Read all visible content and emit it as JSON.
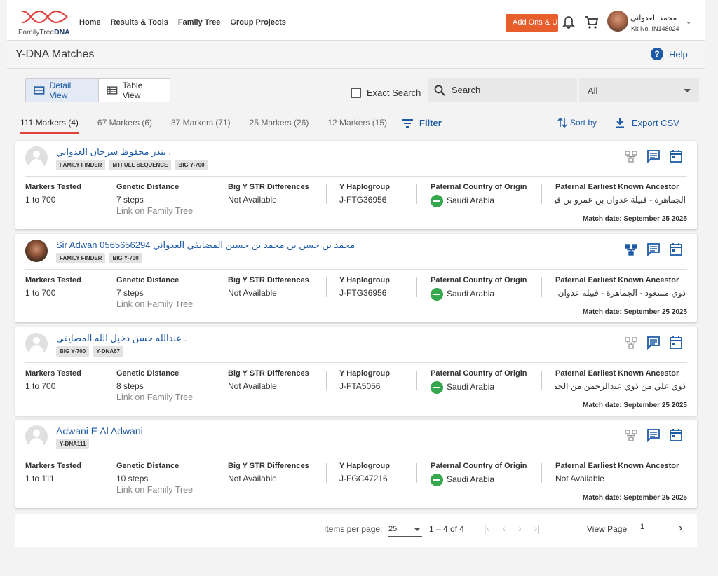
{
  "nav": {
    "logo_text_1": "FamilyTree",
    "logo_text_2": "DNA",
    "links": [
      "Home",
      "Results & Tools",
      "Family Tree",
      "Group Projects"
    ],
    "addons_label": "Add Ons & Upgrades",
    "user_name": "محمد العدواني",
    "kit_no": "Kit No. IN148024"
  },
  "page": {
    "title": "Y-DNA Matches",
    "help_label": "Help"
  },
  "toolbar": {
    "detail_view": "Detail View",
    "table_view": "Table View",
    "exact_search": "Exact Search",
    "search_placeholder": "Search",
    "search_scope": "All"
  },
  "tabs": [
    "111 Markers (4)",
    "67 Markers (6)",
    "37 Markers (71)",
    "25 Markers (26)",
    "12 Markers (15)"
  ],
  "actions": {
    "filter": "Filter",
    "sort_by": "Sort by",
    "export": "Export CSV"
  },
  "columns": {
    "markers": "Markers Tested",
    "distance": "Genetic Distance",
    "bigy": "Big Y STR Differences",
    "haplo": "Y Haplogroup",
    "country": "Paternal Country of Origin",
    "ancestor": "Paternal Earliest Known Ancestor",
    "link": "Link on Family Tree"
  },
  "matches": [
    {
      "name": "بندر محفوظ سرحان العدواني .",
      "badges": [
        "FAMILY FINDER",
        "MTFULL SEQUENCE",
        "BIG Y-700"
      ],
      "markers": "1 to 700",
      "distance": "7 steps",
      "bigy": "Not Available",
      "haplo": "J-FTG36956",
      "country": "Saudi Arabia",
      "ancestor": "الجماهرة - قبيلة عدوان بن عمرو بن قيس عيلان",
      "match_date": "Match date: September 25 2025"
    },
    {
      "name": "Sir Adwan 0565656294 محمد بن حسن بن محمد بن حسين المضايفي العدواني",
      "badges": [
        "FAMILY FINDER",
        "BIG Y-700"
      ],
      "markers": "1 to 700",
      "distance": "7 steps",
      "bigy": "Not Available",
      "haplo": "J-FTG36956",
      "country": "Saudi Arabia",
      "ancestor": "ذوي مسعود - الجماهرة - قبيلة عدوان",
      "match_date": "Match date: September 25 2025"
    },
    {
      "name": "عبدالله حسن دخيل الله المضايفي .",
      "badges": [
        "BIG Y-700",
        "Y-DNA67"
      ],
      "markers": "1 to 700",
      "distance": "8 steps",
      "bigy": "Not Available",
      "haplo": "J-FTA5056",
      "country": "Saudi Arabia",
      "ancestor": "ذوي علي من ذوي عبدالرحمن من الجماهرة...",
      "match_date": "Match date: September 25 2025"
    },
    {
      "name": "Adwani E Al Adwani",
      "badges": [
        "Y-DNA111"
      ],
      "markers": "1 to 111",
      "distance": "10 steps",
      "bigy": "Not Available",
      "haplo": "J-FGC47216",
      "country": "Saudi Arabia",
      "ancestor": "Not Available",
      "match_date": "Match date: September 25 2025"
    }
  ],
  "pager": {
    "items_label": "Items per page:",
    "items_value": "25",
    "range": "1 – 4 of 4",
    "view_page_label": "View Page",
    "page_value": "1"
  },
  "colors": {
    "brand_blue": "#1d5aa6",
    "accent_orange": "#e85d2c",
    "tab_underline": "#e0413a",
    "flag_green": "#35a74f"
  }
}
